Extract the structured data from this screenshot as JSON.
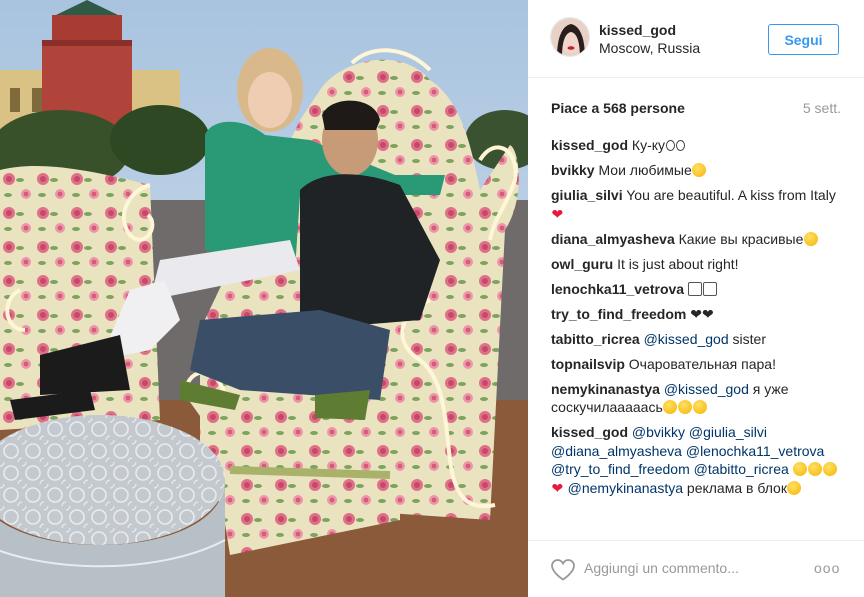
{
  "post": {
    "username": "kissed_god",
    "location": "Moscow, Russia",
    "follow_label": "Segui",
    "likes_text": "Piace a 568 persone",
    "time_ago": "5 sett."
  },
  "comments": [
    {
      "author": "kissed_god",
      "parts": [
        {
          "t": "text",
          "v": " Ку-ку"
        },
        {
          "t": "emoji",
          "k": "eyes"
        },
        {
          "t": "emoji",
          "k": "eyes"
        }
      ]
    },
    {
      "author": "bvikky",
      "parts": [
        {
          "t": "text",
          "v": " Мои любимые"
        },
        {
          "t": "emoji",
          "k": "smile"
        }
      ]
    },
    {
      "author": "giulia_silvi",
      "parts": [
        {
          "t": "text",
          "v": " You are beautiful. A kiss from Italy"
        },
        {
          "t": "emoji",
          "k": "heart"
        }
      ]
    },
    {
      "author": "diana_almyasheva",
      "parts": [
        {
          "t": "text",
          "v": " Какие вы красивые"
        },
        {
          "t": "emoji",
          "k": "smile"
        }
      ]
    },
    {
      "author": "owl_guru",
      "parts": [
        {
          "t": "text",
          "v": " It is just about right!"
        }
      ]
    },
    {
      "author": "lenochka11_vetrova",
      "parts": [
        {
          "t": "text",
          "v": " "
        },
        {
          "t": "emoji",
          "k": "box"
        },
        {
          "t": "emoji",
          "k": "box"
        }
      ]
    },
    {
      "author": "try_to_find_freedom",
      "parts": [
        {
          "t": "text",
          "v": " ❤❤"
        }
      ]
    },
    {
      "author": "tabitto_ricrea",
      "parts": [
        {
          "t": "text",
          "v": " "
        },
        {
          "t": "mention",
          "v": "@kissed_god"
        },
        {
          "t": "text",
          "v": " sister"
        }
      ]
    },
    {
      "author": "topnailsvip",
      "parts": [
        {
          "t": "text",
          "v": " Очаровательная пара!"
        }
      ]
    },
    {
      "author": "nemykinanastya",
      "parts": [
        {
          "t": "text",
          "v": " "
        },
        {
          "t": "mention",
          "v": "@kissed_god"
        },
        {
          "t": "text",
          "v": " я уже соскучилааааась"
        },
        {
          "t": "emoji",
          "k": "smile"
        },
        {
          "t": "emoji",
          "k": "smile"
        },
        {
          "t": "emoji",
          "k": "smile"
        }
      ]
    },
    {
      "author": "kissed_god",
      "parts": [
        {
          "t": "text",
          "v": " "
        },
        {
          "t": "mention",
          "v": "@bvikky"
        },
        {
          "t": "text",
          "v": " "
        },
        {
          "t": "mention",
          "v": "@giulia_silvi"
        },
        {
          "t": "text",
          "v": " "
        },
        {
          "t": "mention",
          "v": "@diana_almyasheva"
        },
        {
          "t": "text",
          "v": " "
        },
        {
          "t": "mention",
          "v": "@lenochka11_vetrova"
        },
        {
          "t": "text",
          "v": " "
        },
        {
          "t": "mention",
          "v": "@try_to_find_freedom"
        },
        {
          "t": "text",
          "v": " "
        },
        {
          "t": "mention",
          "v": "@tabitto_ricrea"
        },
        {
          "t": "text",
          "v": " "
        },
        {
          "t": "emoji",
          "k": "smile"
        },
        {
          "t": "emoji",
          "k": "smile"
        },
        {
          "t": "emoji",
          "k": "smile"
        },
        {
          "t": "emoji",
          "k": "heart"
        },
        {
          "t": "text",
          "v": " "
        },
        {
          "t": "mention",
          "v": "@nemykinanastya"
        },
        {
          "t": "text",
          "v": " реклама в блок"
        },
        {
          "t": "emoji",
          "k": "smile"
        }
      ]
    }
  ],
  "footer": {
    "comment_placeholder": "Aggiungi un commento...",
    "more_label": "ooo"
  },
  "icons": {
    "like": "heart-outline-icon",
    "more": "more-options-icon"
  },
  "colors": {
    "follow_blue": "#3897f0",
    "mention_blue": "#003569",
    "muted": "#999999"
  }
}
